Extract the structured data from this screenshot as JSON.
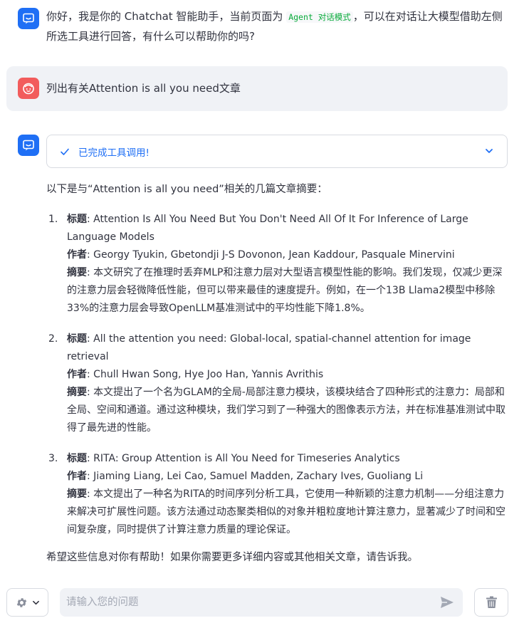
{
  "welcome": {
    "prefix": "你好，我是你的 Chatchat 智能助手，当前页面为 ",
    "mode_code": "Agent 对话模式",
    "suffix": "，可以在对话让大模型借助左侧所选工具进行回答，有什么可以帮助你的吗?"
  },
  "user_message": "列出有关Attention is all you need文章",
  "tool_status": "已完成工具调用!",
  "answer": {
    "intro": "以下是与“Attention is all you need”相关的几篇文章摘要：",
    "labels": {
      "title": "标题",
      "authors": "作者",
      "summary": "摘要"
    },
    "papers": [
      {
        "num": "1.",
        "title": "Attention Is All You Need But You Don't Need All Of It For Inference of Large Language Models",
        "authors": "Georgy Tyukin, Gbetondji J-S Dovonon, Jean Kaddour, Pasquale Minervini",
        "summary": "本文研究了在推理时丢弃MLP和注意力层对大型语言模型性能的影响。我们发现，仅减少更深的注意力层会轻微降低性能，但可以带来最佳的速度提升。例如，在一个13B Llama2模型中移除33%的注意力层会导致OpenLLM基准测试中的平均性能下降1.8%。"
      },
      {
        "num": "2.",
        "title": "All the attention you need: Global-local, spatial-channel attention for image retrieval",
        "authors": "Chull Hwan Song, Hye Joo Han, Yannis Avrithis",
        "summary": "本文提出了一个名为GLAM的全局-局部注意力模块，该模块结合了四种形式的注意力：局部和全局、空间和通道。通过这种模块，我们学习到了一种强大的图像表示方法，并在标准基准测试中取得了最先进的性能。"
      },
      {
        "num": "3.",
        "title": "RITA: Group Attention is All You Need for Timeseries Analytics",
        "authors": "Jiaming Liang, Lei Cao, Samuel Madden, Zachary Ives, Guoliang Li",
        "summary": "本文提出了一种名为RITA的时间序列分析工具，它使用一种新颖的注意力机制——分组注意力来解决可扩展性问题。该方法通过动态聚类相似的对象并粗粒度地计算注意力，显著减少了时间和空间复杂度，同时提供了计算注意力质量的理论保证。"
      }
    ],
    "closing": "希望这些信息对你有帮助！如果你需要更多详细内容或其他相关文章，请告诉我。"
  },
  "input": {
    "placeholder": "请输入您的问题",
    "value": ""
  },
  "colors": {
    "accent": "#1f6ff5",
    "user_avatar": "#f25c5c",
    "code_green": "#09ab3b"
  },
  "icons": [
    "chat-bot-icon",
    "user-face-icon",
    "check-icon",
    "chevron-down-icon",
    "gear-icon",
    "send-icon",
    "trash-icon"
  ]
}
